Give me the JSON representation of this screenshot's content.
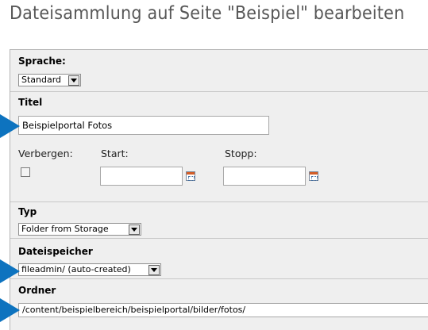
{
  "page": {
    "title": "Dateisammlung auf Seite \"Beispiel\" bearbeiten"
  },
  "language": {
    "label": "Sprache:",
    "value": "Standard"
  },
  "title_field": {
    "label": "Titel",
    "value": "Beispielportal Fotos"
  },
  "visibility": {
    "hide_label": "Verbergen:",
    "start_label": "Start:",
    "stop_label": "Stopp:",
    "start_value": "",
    "stop_value": ""
  },
  "type": {
    "label": "Typ",
    "value": "Folder from Storage"
  },
  "storage": {
    "label": "Dateispeicher",
    "value": "fileadmin/ (auto-created)"
  },
  "folder": {
    "label": "Ordner",
    "value": "/content/beispielbereich/beispielportal/bilder/fotos/"
  },
  "colors": {
    "marker": "#0d73bf",
    "panel": "#efefef",
    "title": "#575757"
  }
}
